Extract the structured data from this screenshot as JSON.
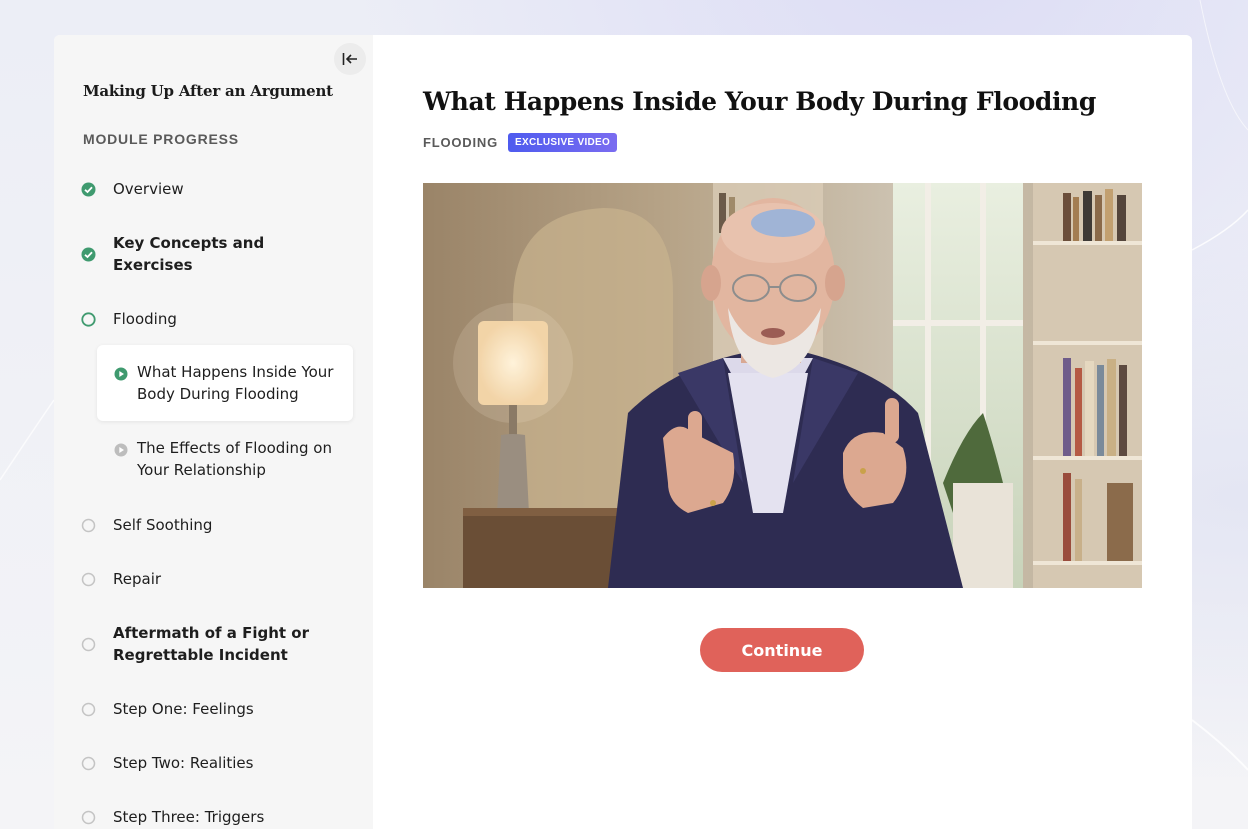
{
  "sidebar": {
    "course_title": "Making Up After an Argument",
    "progress_label": "MODULE PROGRESS",
    "items": [
      {
        "label": "Overview",
        "status": "complete"
      },
      {
        "label": "Key Concepts and Exercises",
        "status": "complete"
      },
      {
        "label": "Flooding",
        "status": "in-progress"
      },
      {
        "label": "What Happens Inside Your Body During Flooding",
        "status": "playing",
        "sub": true,
        "active": true
      },
      {
        "label": "The Effects of Flooding on Your Relationship",
        "status": "unplayed",
        "sub": true
      },
      {
        "label": "Self Soothing",
        "status": "not-started"
      },
      {
        "label": "Repair",
        "status": "not-started"
      },
      {
        "label": "Aftermath of a Fight or Regrettable Incident",
        "status": "not-started"
      },
      {
        "label": "Step One: Feelings",
        "status": "not-started"
      },
      {
        "label": "Step Two: Realities",
        "status": "not-started"
      },
      {
        "label": "Step Three: Triggers",
        "status": "not-started"
      }
    ]
  },
  "main": {
    "title": "What Happens Inside Your Body During Flooding",
    "module_tag": "FLOODING",
    "badge": "EXCLUSIVE VIDEO",
    "continue_label": "Continue"
  },
  "colors": {
    "complete": "#3f9a6f",
    "accent_button": "#e0625a",
    "badge_start": "#4e5bef",
    "badge_end": "#7a6cf0"
  }
}
